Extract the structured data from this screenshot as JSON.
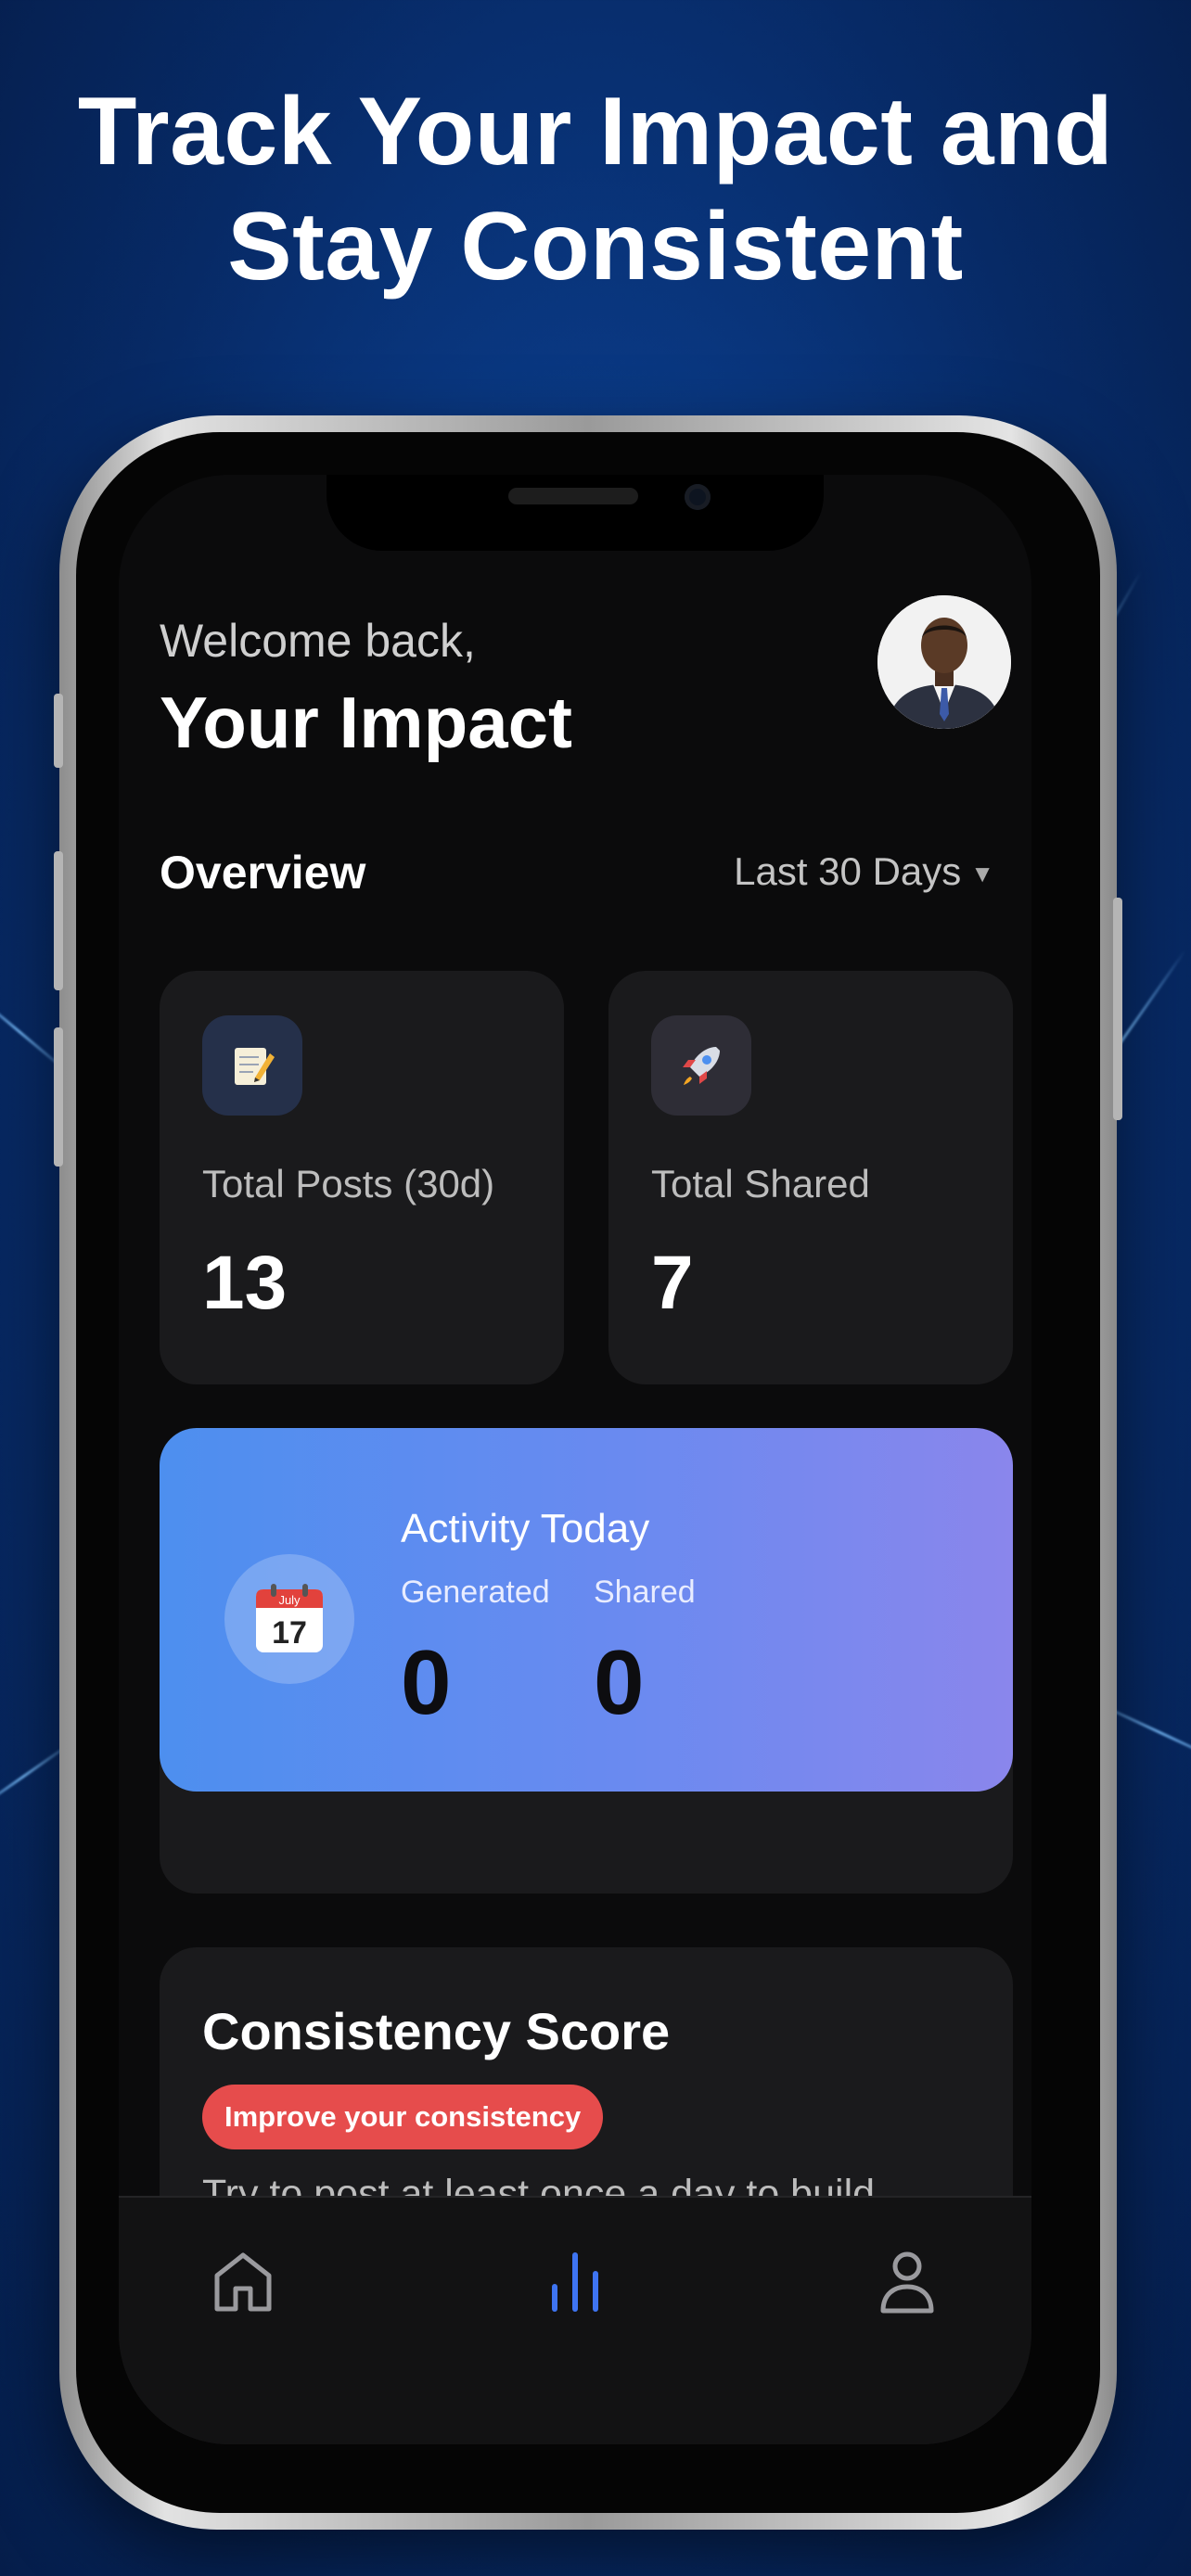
{
  "promo": {
    "headline_line1": "Track Your Impact and",
    "headline_line2": "Stay Consistent"
  },
  "header": {
    "welcome": "Welcome back,",
    "title": "Your Impact",
    "avatar_icon": "profile-photo"
  },
  "overview": {
    "title": "Overview",
    "range_label": "Last 30 Days",
    "range_icon": "caret-down-icon"
  },
  "stats": [
    {
      "icon": "memo-icon",
      "label": "Total Posts (30d)",
      "value": "13"
    },
    {
      "icon": "rocket-icon",
      "label": "Total Shared",
      "value": "7"
    }
  ],
  "activity": {
    "title": "Activity Today",
    "calendar_month": "July",
    "calendar_day": "17",
    "generated_label": "Generated",
    "generated_value": "0",
    "shared_label": "Shared",
    "shared_value": "0",
    "gradient_start": "#4d8fef",
    "gradient_end": "#8a86ec"
  },
  "consistency": {
    "title": "Consistency Score",
    "badge": "Improve your consistency",
    "message": "Try to post at least once a day to build momentum!",
    "badge_color": "#e64c4c"
  },
  "tabbar": {
    "tabs": [
      {
        "icon": "home-icon",
        "active": false
      },
      {
        "icon": "bar-chart-icon",
        "active": true
      },
      {
        "icon": "profile-icon",
        "active": false
      }
    ],
    "active_color": "#3e74f2"
  }
}
